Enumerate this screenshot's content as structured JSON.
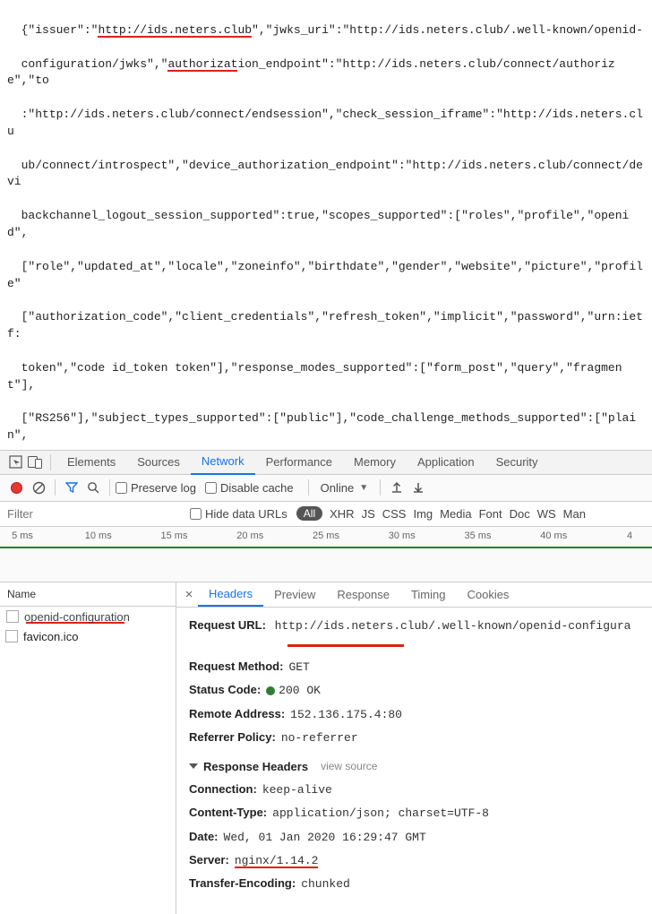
{
  "json_response": {
    "line1_pre": "{\"issuer\":\"",
    "line1_ul": "http://ids.neters.club",
    "line1_post": "\",\"jwks_uri\":\"http://ids.neters.club/.well-known/openid-",
    "line2_pre": "configuration/jwks\",\"",
    "line2_ul": "authorizat",
    "line2_post": "ion_endpoint\":\"http://ids.neters.club/connect/authorize\",\"to",
    "line3": ":\"http://ids.neters.club/connect/endsession\",\"check_session_iframe\":\"http://ids.neters.clu",
    "line4": "ub/connect/introspect\",\"device_authorization_endpoint\":\"http://ids.neters.club/connect/devi",
    "line5": "backchannel_logout_session_supported\":true,\"scopes_supported\":[\"roles\",\"profile\",\"openid\",",
    "line6": "[\"role\",\"updated_at\",\"locale\",\"zoneinfo\",\"birthdate\",\"gender\",\"website\",\"picture\",\"profile\"",
    "line7": "[\"authorization_code\",\"client_credentials\",\"refresh_token\",\"implicit\",\"password\",\"urn:ietf:",
    "line8": "token\",\"code id_token token\"],\"response_modes_supported\":[\"form_post\",\"query\",\"fragment\"],",
    "line9": "[\"RS256\"],\"subject_types_supported\":[\"public\"],\"code_challenge_methods_supported\":[\"plain\","
  },
  "devtools_tabs": [
    "Elements",
    "Sources",
    "Network",
    "Performance",
    "Memory",
    "Application",
    "Security"
  ],
  "devtools_active": "Network",
  "toolbar": {
    "preserve_log": "Preserve log",
    "disable_cache": "Disable cache",
    "online": "Online"
  },
  "filter": {
    "placeholder": "Filter",
    "hide_data_urls": "Hide data URLs",
    "types": [
      "All",
      "XHR",
      "JS",
      "CSS",
      "Img",
      "Media",
      "Font",
      "Doc",
      "WS",
      "Man"
    ],
    "active": "All"
  },
  "timeline": {
    "ticks": [
      "5 ms",
      "10 ms",
      "15 ms",
      "20 ms",
      "25 ms",
      "30 ms",
      "35 ms",
      "40 ms",
      "4"
    ]
  },
  "requests": {
    "header": "Name",
    "items": [
      "openid-configuration",
      "favicon.ico"
    ]
  },
  "detail_tabs": [
    "Headers",
    "Preview",
    "Response",
    "Timing",
    "Cookies"
  ],
  "detail_active": "Headers",
  "general": {
    "url_label": "Request URL:",
    "url_value": "http://ids.neters.club/.well-known/openid-configura",
    "method_label": "Request Method:",
    "method_value": "GET",
    "status_label": "Status Code:",
    "status_value": "200 OK",
    "remote_label": "Remote Address:",
    "remote_value": "152.136.175.4:80",
    "referrer_label": "Referrer Policy:",
    "referrer_value": "no-referrer"
  },
  "response_headers": {
    "section_title": "Response Headers",
    "view_source": "view source",
    "items": [
      {
        "k": "Connection:",
        "v": "keep-alive"
      },
      {
        "k": "Content-Type:",
        "v": "application/json; charset=UTF-8"
      },
      {
        "k": "Date:",
        "v": "Wed, 01 Jan 2020 16:29:47 GMT"
      },
      {
        "k": "Server:",
        "v": "nginx/1.14.2",
        "underline": true
      },
      {
        "k": "Transfer-Encoding:",
        "v": "chunked"
      }
    ]
  }
}
